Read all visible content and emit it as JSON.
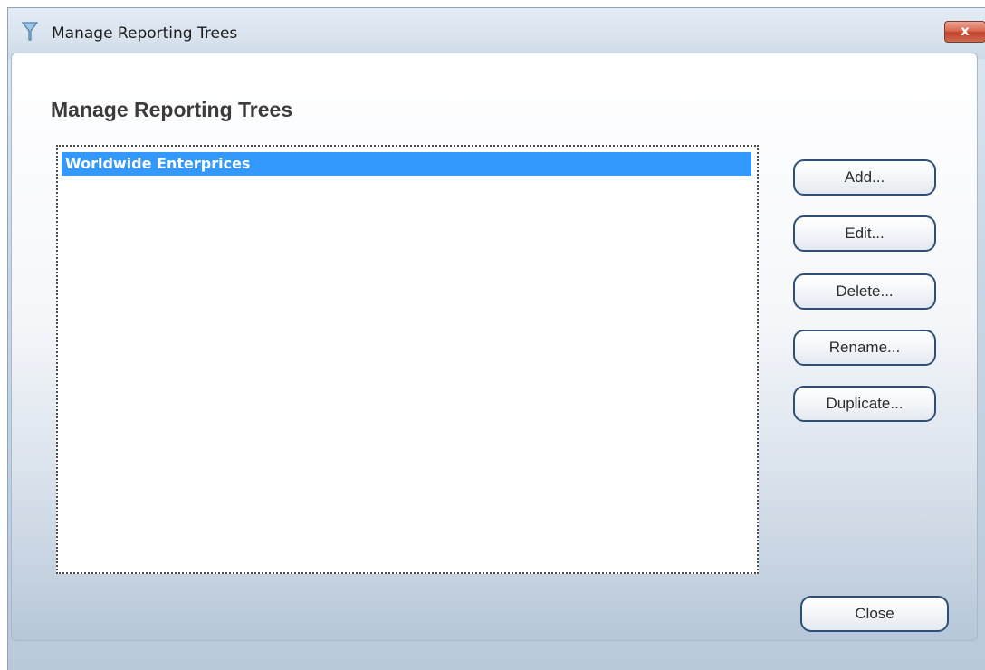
{
  "window": {
    "title": "Manage Reporting Trees",
    "close_glyph": "x",
    "icon": "funnel-icon"
  },
  "main": {
    "heading": "Manage Reporting Trees",
    "list_items": [
      {
        "label": "Worldwide Enterprices",
        "selected": true
      }
    ]
  },
  "buttons": {
    "add": "Add...",
    "edit": "Edit...",
    "delete": "Delete...",
    "rename": "Rename...",
    "duplicate": "Duplicate...",
    "close": "Close"
  },
  "colors": {
    "selection": "#3399ff",
    "button_border": "#2d4f76",
    "close_button": "#c0422a"
  }
}
